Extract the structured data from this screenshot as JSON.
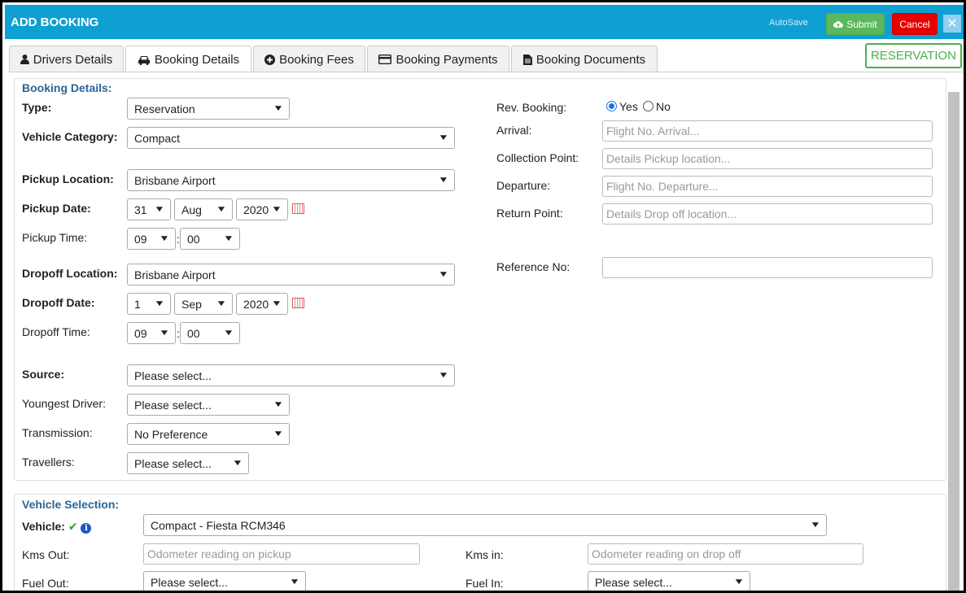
{
  "header": {
    "title": "ADD BOOKING",
    "autosave_label": "AutoSave",
    "submit_label": "Submit",
    "cancel_label": "Cancel",
    "close_glyph": "✕"
  },
  "tabs": [
    {
      "label": "Drivers Details",
      "icon": "user-icon"
    },
    {
      "label": "Booking Details",
      "icon": "car-icon"
    },
    {
      "label": "Booking Fees",
      "icon": "plus-circle-icon"
    },
    {
      "label": "Booking Payments",
      "icon": "credit-card-icon"
    },
    {
      "label": "Booking Documents",
      "icon": "document-icon"
    }
  ],
  "status_badge": "RESERVATION",
  "booking": {
    "legend": "Booking Details:",
    "type_label": "Type:",
    "type_value": "Reservation",
    "vehicle_category_label": "Vehicle Category:",
    "vehicle_category_value": "Compact",
    "pickup_location_label": "Pickup Location:",
    "pickup_location_value": "Brisbane Airport",
    "pickup_date_label": "Pickup Date:",
    "pickup_day": "31",
    "pickup_month": "Aug",
    "pickup_year": "2020",
    "pickup_time_label": "Pickup Time:",
    "pickup_hour": "09",
    "pickup_minute": "00",
    "dropoff_location_label": "Dropoff Location:",
    "dropoff_location_value": "Brisbane Airport",
    "dropoff_date_label": "Dropoff Date:",
    "dropoff_day": "1",
    "dropoff_month": "Sep",
    "dropoff_year": "2020",
    "dropoff_time_label": "Dropoff Time:",
    "dropoff_hour": "09",
    "dropoff_minute": "00",
    "source_label": "Source:",
    "source_value": "Please select...",
    "youngest_driver_label": "Youngest Driver:",
    "youngest_driver_value": "Please select...",
    "transmission_label": "Transmission:",
    "transmission_value": "No Preference",
    "travellers_label": "Travellers:",
    "travellers_value": "Please select...",
    "rev_booking_label": "Rev. Booking:",
    "rev_yes_label": "Yes",
    "rev_no_label": "No",
    "rev_selected": "Yes",
    "arrival_label": "Arrival:",
    "arrival_placeholder": "Flight No. Arrival...",
    "collection_label": "Collection Point:",
    "collection_placeholder": "Details Pickup location...",
    "departure_label": "Departure:",
    "departure_placeholder": "Flight No. Departure...",
    "return_label": "Return Point:",
    "return_placeholder": "Details Drop off location...",
    "reference_label": "Reference No:",
    "reference_value": ""
  },
  "vehicle": {
    "legend": "Vehicle Selection:",
    "vehicle_label": "Vehicle:",
    "vehicle_value": "Compact - Fiesta RCM346",
    "kms_out_label": "Kms Out:",
    "kms_out_placeholder": "Odometer reading on pickup",
    "kms_in_label": "Kms in:",
    "kms_in_placeholder": "Odometer reading on drop off",
    "fuel_out_label": "Fuel Out:",
    "fuel_out_value": "Please select...",
    "fuel_in_label": "Fuel In:",
    "fuel_in_value": "Please select..."
  },
  "colors": {
    "header_bg": "#0e9fd3",
    "submit_bg": "#5cb85c",
    "cancel_bg": "#e60000",
    "legend": "#2a6496",
    "badge": "#4cae4c"
  }
}
